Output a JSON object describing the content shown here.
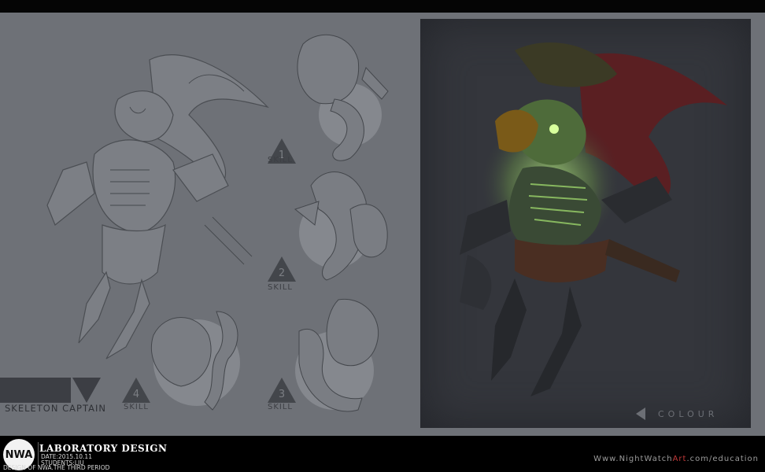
{
  "sheet": {
    "character_name": "SKELETON CAPTAIN",
    "skills": [
      {
        "number": "1",
        "label": "SKILL"
      },
      {
        "number": "2",
        "label": "SKILL"
      },
      {
        "number": "3",
        "label": "SKILL"
      },
      {
        "number": "4",
        "label": "SKILL"
      }
    ],
    "colour_label": "COLOUR"
  },
  "footer": {
    "logo": "NWA",
    "title": "LABORATORY DESIGN",
    "date": "DATE:2015.10.11",
    "students": "STUDENTS:LIU",
    "design": "DESIGN OF NWA.THE THIRD PERIOD",
    "site_prefix": "Www.NightWatch",
    "site_highlight": "Art",
    "site_suffix": ".com/education"
  },
  "colors": {
    "background": "#6e7177",
    "panel": "#34363c",
    "accent_red": "#c23a3a",
    "glow_green": "#9bd26a"
  }
}
